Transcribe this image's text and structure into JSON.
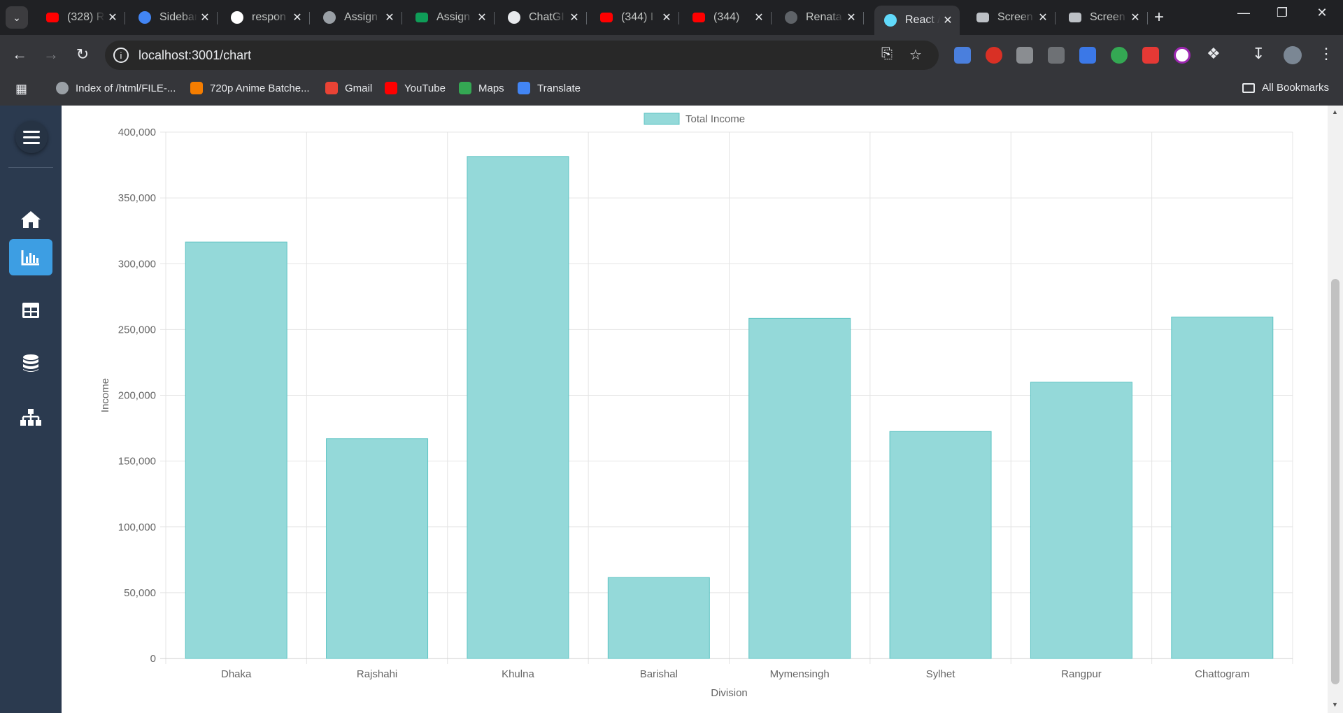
{
  "browser": {
    "tabs": [
      {
        "title": "(328) R",
        "icon": "youtube-icon",
        "color": "#ff0000"
      },
      {
        "title": "Sidebar",
        "icon": "sidebar-site-icon",
        "color": "#4285f4"
      },
      {
        "title": "respon",
        "icon": "google-icon",
        "color": "#ffffff"
      },
      {
        "title": "Assign",
        "icon": "globe-icon",
        "color": "#9aa0a6"
      },
      {
        "title": "Assign",
        "icon": "google-sheets-icon",
        "color": "#0f9d58"
      },
      {
        "title": "ChatGI",
        "icon": "chatgpt-icon",
        "color": "#e8eaed"
      },
      {
        "title": "(344) I",
        "icon": "youtube-icon",
        "color": "#ff0000"
      },
      {
        "title": "(344)",
        "icon": "youtube-icon",
        "color": "#ff0000"
      },
      {
        "title": "Renata",
        "icon": "github-icon",
        "color": "#5f6368"
      },
      {
        "title": "React /",
        "icon": "react-icon",
        "color": "#61dafb",
        "active": true
      },
      {
        "title": "Screen",
        "icon": "camera-icon",
        "color": "#bdc1c6"
      },
      {
        "title": "Screen",
        "icon": "camera-icon",
        "color": "#bdc1c6"
      }
    ],
    "url": "localhost:3001/chart",
    "bookmarks": [
      {
        "label": "Index of /html/FILE-...",
        "icon": "globe-icon",
        "color": "#9aa0a6"
      },
      {
        "label": "720p Anime Batche...",
        "icon": "blogger-icon",
        "color": "#f57d00"
      },
      {
        "label": "Gmail",
        "icon": "gmail-icon",
        "color": "#ea4335"
      },
      {
        "label": "YouTube",
        "icon": "youtube-icon",
        "color": "#ff0000"
      },
      {
        "label": "Maps",
        "icon": "maps-icon",
        "color": "#34a853"
      },
      {
        "label": "Translate",
        "icon": "translate-icon",
        "color": "#4285f4"
      }
    ],
    "all_bookmarks": "All Bookmarks"
  },
  "sidebar": {
    "items": [
      {
        "icon": "home-icon",
        "active": false
      },
      {
        "icon": "bar-chart-icon",
        "active": true
      },
      {
        "icon": "table-icon",
        "active": false
      },
      {
        "icon": "database-icon",
        "active": false
      },
      {
        "icon": "sitemap-icon",
        "active": false
      }
    ],
    "accent": "#3d9ee3",
    "background": "#2b3a4f"
  },
  "chart_data": {
    "type": "bar",
    "categories": [
      "Dhaka",
      "Rajshahi",
      "Khulna",
      "Barishal",
      "Mymensingh",
      "Sylhet",
      "Rangpur",
      "Chattogram"
    ],
    "series": [
      {
        "name": "Total Income",
        "values": [
          316500,
          167000,
          381500,
          61500,
          258500,
          172500,
          210000,
          259500
        ]
      }
    ],
    "xlabel": "Division",
    "ylabel": "Income",
    "ylim": [
      0,
      400000
    ],
    "yticks": [
      "0",
      "50,000",
      "100,000",
      "150,000",
      "200,000",
      "250,000",
      "300,000",
      "350,000",
      "400,000"
    ],
    "grid": true,
    "legend": "top-center",
    "bar_fill": "#94d9d9",
    "bar_stroke": "#5ec4c4"
  }
}
